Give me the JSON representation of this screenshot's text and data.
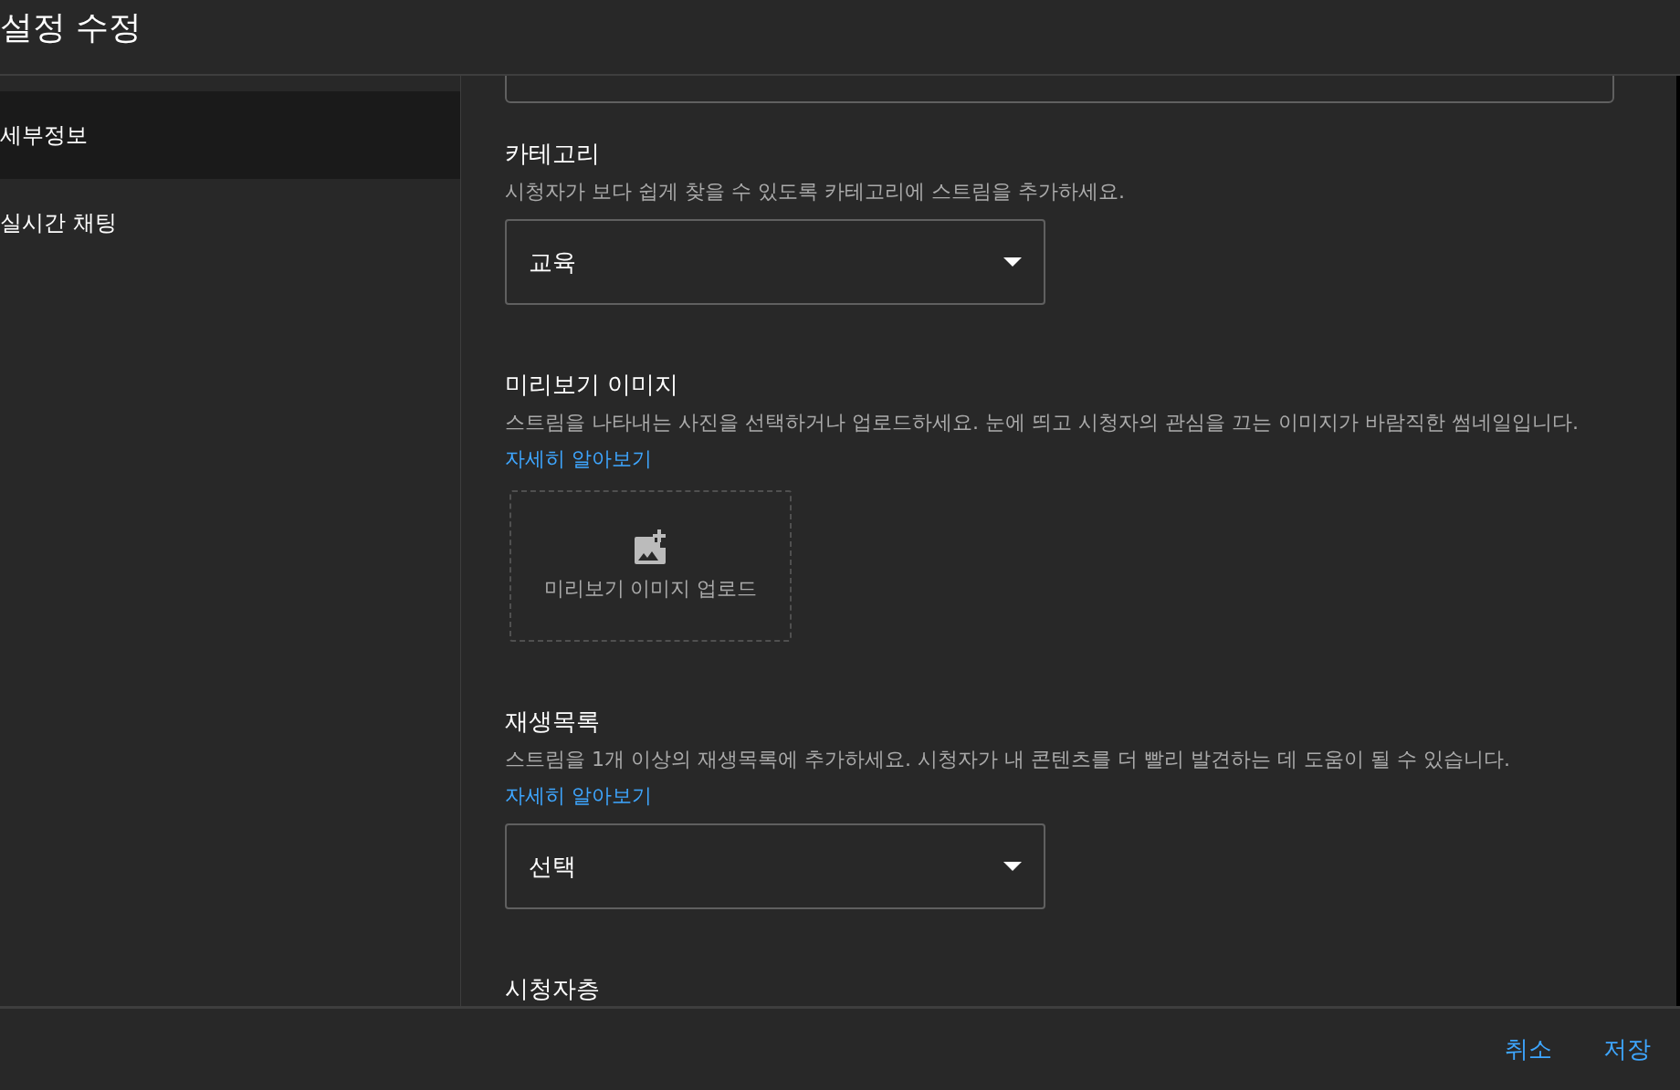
{
  "header": {
    "title": "설정 수정"
  },
  "sidebar": {
    "items": [
      {
        "label": "세부정보",
        "selected": true
      },
      {
        "label": "실시간 채팅",
        "selected": false
      }
    ]
  },
  "sections": [
    {
      "kind": "field"
    },
    {
      "kind": "dropdown",
      "heading": "카테고리",
      "description": "시청자가 보다 쉽게 찾을 수 있도록 카테고리에 스트림을 추가하세요.",
      "value": "교육"
    },
    {
      "kind": "upload",
      "heading": "미리보기 이미지",
      "description": "스트림을 나타내는 사진을 선택하거나 업로드하세요. 눈에 띄고 시청자의 관심을 끄는 이미지가 바람직한 썸네일입니다.",
      "link": "자세히 알아보기",
      "upload_label": "미리보기 이미지 업로드"
    },
    {
      "kind": "dropdown",
      "heading": "재생목록",
      "description": "스트림을 1개 이상의 재생목록에 추가하세요. 시청자가 내 콘텐츠를 더 빨리 발견하는 데 도움이 될 수 있습니다.",
      "link": "자세히 알아보기",
      "value": "선택"
    },
    {
      "kind": "heading",
      "heading": "시청자층"
    }
  ],
  "footer": {
    "buttons": [
      "취소",
      "저장"
    ]
  }
}
